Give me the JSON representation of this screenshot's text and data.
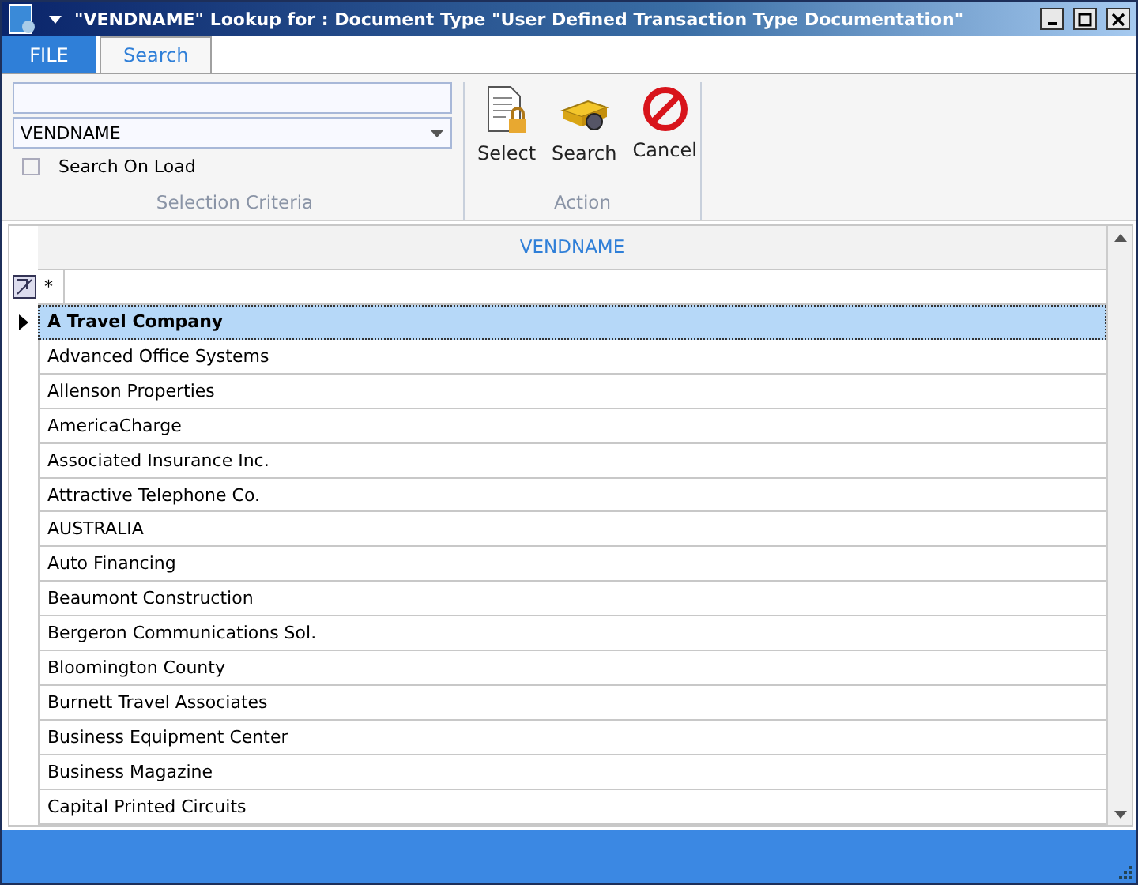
{
  "window": {
    "title": "\"VENDNAME\" Lookup for : Document Type \"User Defined Transaction Type Documentation\""
  },
  "tabs": [
    {
      "label": "FILE",
      "kind": "file",
      "selected": false
    },
    {
      "label": "Search",
      "kind": "tab",
      "selected": true
    }
  ],
  "selection_criteria": {
    "column_dropdown": {
      "value": "VENDNAME"
    },
    "search_on_load": {
      "label": "Search On Load",
      "checked": false
    },
    "group_label": "Selection Criteria"
  },
  "action": {
    "buttons": [
      {
        "label": "Select",
        "kind": "select"
      },
      {
        "label": "Search",
        "kind": "search"
      },
      {
        "label": "Cancel",
        "kind": "cancel"
      }
    ],
    "group_label": "Action"
  },
  "table": {
    "columns": [
      "VENDNAME"
    ],
    "filter": "*",
    "rows": [
      {
        "name": "A Travel Company",
        "selected": true
      },
      {
        "name": "Advanced Office Systems",
        "selected": false
      },
      {
        "name": "Allenson Properties",
        "selected": false
      },
      {
        "name": "AmericaCharge",
        "selected": false
      },
      {
        "name": "Associated Insurance Inc.",
        "selected": false
      },
      {
        "name": "Attractive Telephone Co.",
        "selected": false
      },
      {
        "name": "AUSTRALIA",
        "selected": false
      },
      {
        "name": "Auto Financing",
        "selected": false
      },
      {
        "name": "Beaumont Construction",
        "selected": false
      },
      {
        "name": "Bergeron Communications Sol.",
        "selected": false
      },
      {
        "name": "Bloomington County",
        "selected": false
      },
      {
        "name": "Burnett Travel Associates",
        "selected": false
      },
      {
        "name": "Business Equipment Center",
        "selected": false
      },
      {
        "name": "Business Magazine",
        "selected": false
      },
      {
        "name": "Capital Printed Circuits",
        "selected": false
      }
    ]
  }
}
